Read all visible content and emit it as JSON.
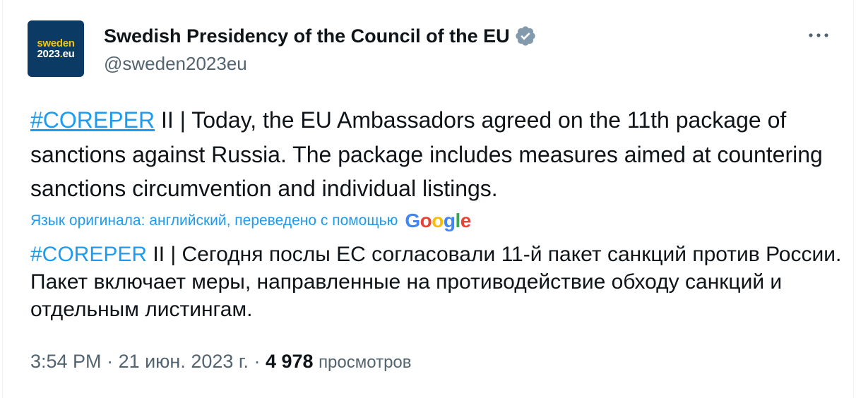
{
  "account": {
    "avatar_line1": "sweden",
    "avatar_line2_a": "2023",
    "avatar_line2_b": ".",
    "avatar_line2_c": "eu",
    "name": "Swedish Presidency of the Council of the EU",
    "handle": "@sweden2023eu",
    "verified_icon": "verified-badge-icon",
    "more_icon": "more-options-icon"
  },
  "tweet": {
    "hashtag": "#COREPER",
    "text_en": " II | Today, the EU Ambassadors agreed on the 11th package of sanctions against Russia. The package includes measures aimed at countering sanctions circumvention and individual listings.",
    "translation_label": "Язык оригинала: английский, переведено с помощью",
    "google_logo": [
      "G",
      "o",
      "o",
      "g",
      "l",
      "e"
    ],
    "text_ru": " II | Сегодня послы ЕС согласовали 11-й пакет санкций против России. Пакет включает меры, направленные на противодействие обходу санкций и отдельным листингам."
  },
  "meta": {
    "time": "3:54 PM",
    "separator": " · ",
    "date": "21 июн. 2023 г.",
    "views_count": "4 978",
    "views_label": "просмотров"
  },
  "colors": {
    "link": "#1d9bf0",
    "text": "#0f1419",
    "secondary": "#536471",
    "avatar_bg": "#0b3a64",
    "avatar_accent": "#f5c400",
    "google_blue": "#4285f4",
    "google_red": "#ea4335",
    "google_yellow": "#fbbc05",
    "google_green": "#34a853"
  }
}
